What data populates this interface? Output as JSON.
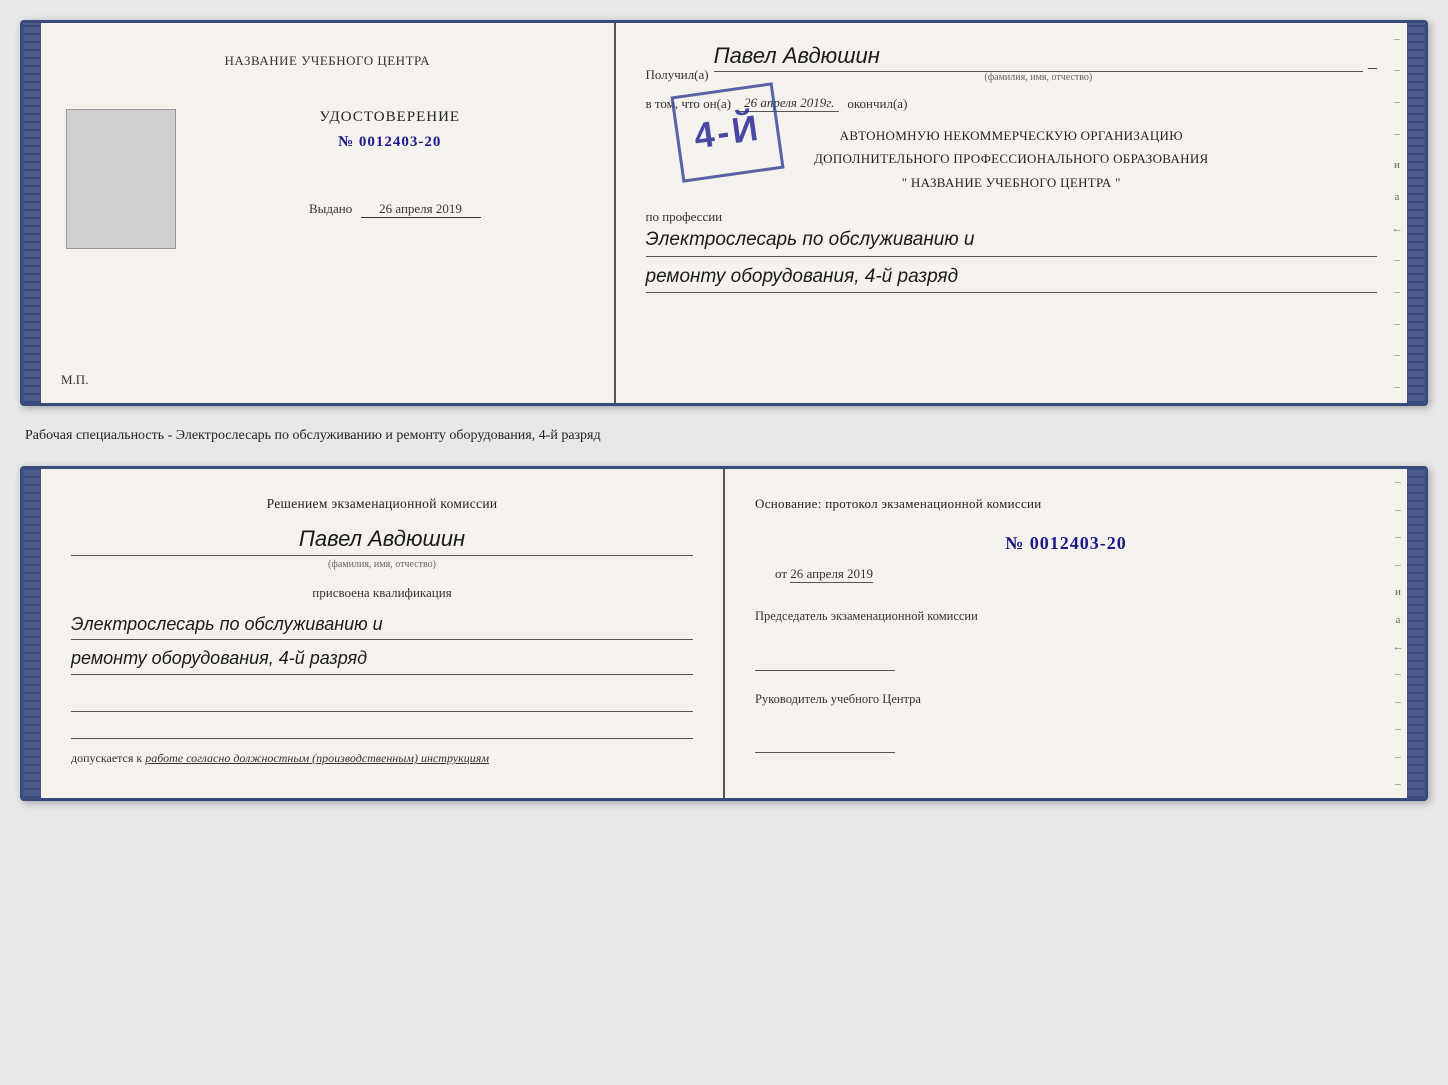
{
  "page": {
    "background_color": "#e8e8e8"
  },
  "top_booklet": {
    "left_page": {
      "title": "НАЗВАНИЕ УЧЕБНОГО ЦЕНТРА",
      "cert_label": "УДОСТОВЕРЕНИЕ",
      "cert_number": "№ 0012403-20",
      "issued_label": "Выдано",
      "issued_date": "26 апреля 2019",
      "mp_label": "М.П."
    },
    "right_page": {
      "received_label": "Получил(а)",
      "recipient_name": "Павел Авдюшин",
      "fio_sublabel": "(фамилия, имя, отчество)",
      "in_that_label": "в том, что он(а)",
      "date_value": "26 апреля 2019г.",
      "finished_label": "окончил(а)",
      "stamp_text": "4-й",
      "org_line1": "АВТОНОМНУЮ НЕКОММЕРЧЕСКУЮ ОРГАНИЗАЦИЮ",
      "org_line2": "ДОПОЛНИТЕЛЬНОГО ПРОФЕССИОНАЛЬНОГО ОБРАЗОВАНИЯ",
      "org_line3": "\" НАЗВАНИЕ УЧЕБНОГО ЦЕНТРА \"",
      "profession_label": "по профессии",
      "profession_line1": "Электрослесарь по обслуживанию и",
      "profession_line2": "ремонту оборудования, 4-й разряд",
      "side_dashes": [
        "–",
        "–",
        "–",
        "–",
        "и",
        "а",
        "←",
        "–",
        "–",
        "–",
        "–",
        "–"
      ]
    }
  },
  "middle_section": {
    "text": "Рабочая специальность - Электрослесарь по обслуживанию и ремонту оборудования, 4-й разряд"
  },
  "bottom_booklet": {
    "left_page": {
      "decision_title": "Решением экзаменационной комиссии",
      "person_name": "Павел Авдюшин",
      "fio_sublabel": "(фамилия, имя, отчество)",
      "qualification_label": "присвоена квалификация",
      "qualification_line1": "Электрослесарь по обслуживанию и",
      "qualification_line2": "ремонту оборудования, 4-й разряд",
      "допускается_label": "допускается к",
      "допускается_value": "работе согласно должностным (производственным) инструкциям"
    },
    "right_page": {
      "basis_text": "Основание: протокол экзаменационной  комиссии",
      "protocol_number": "№  0012403-20",
      "date_prefix": "от",
      "date_value": "26 апреля 2019",
      "chairman_label": "Председатель экзаменационной комиссии",
      "head_label": "Руководитель учебного Центра",
      "side_dashes": [
        "–",
        "–",
        "–",
        "–",
        "и",
        "а",
        "←",
        "–",
        "–",
        "–",
        "–",
        "–"
      ]
    }
  }
}
